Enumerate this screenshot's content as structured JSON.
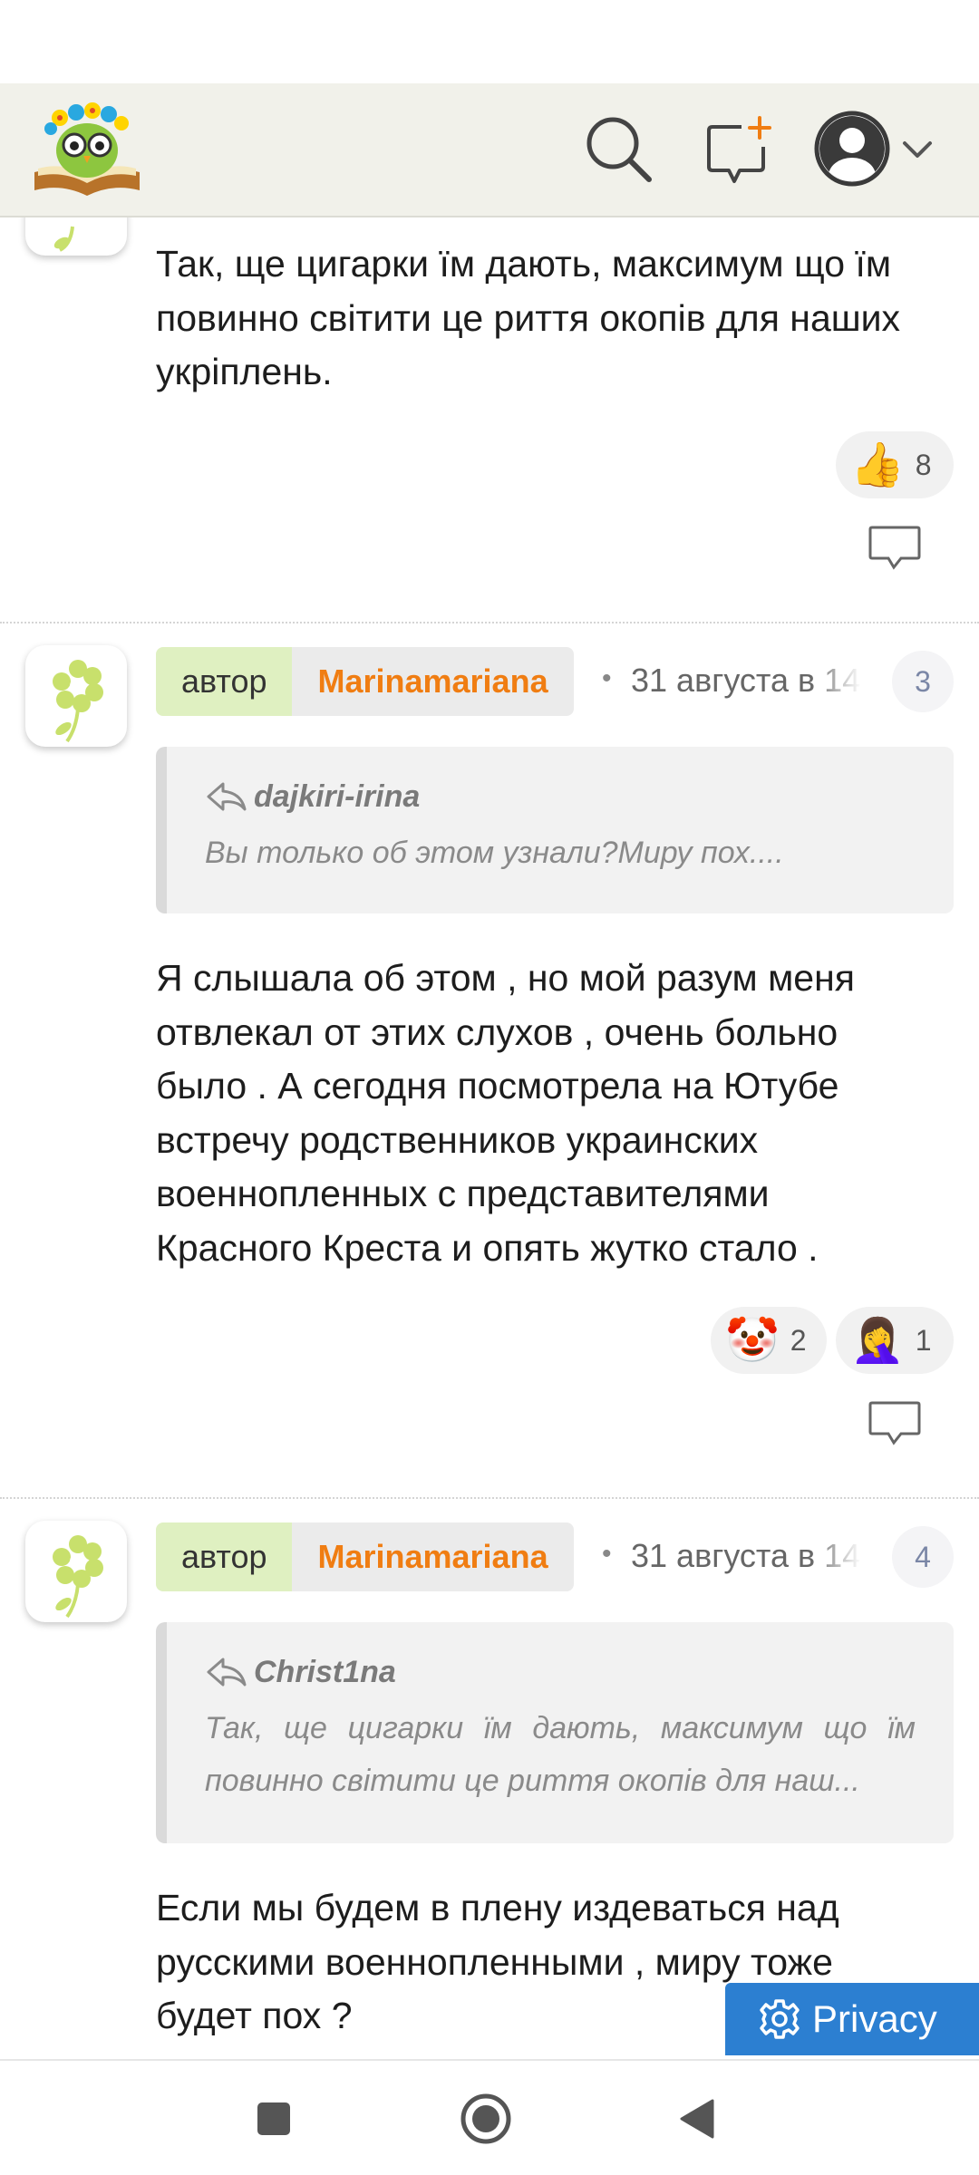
{
  "header": {
    "logo_icon": "owl-on-book-logo-icon",
    "search_icon": "search-icon",
    "new_post_icon": "chat-add-icon",
    "account_icon": "account-icon",
    "menu_icon": "chevron-down-icon"
  },
  "comments": [
    {
      "text": "Так, ще цигарки їм дають, максимум що їм повинно світити це риття окопів для наших укріплень.",
      "reactions": [
        {
          "icon": "thumbs-up-icon",
          "emoji": "👍",
          "count": "8"
        }
      ]
    },
    {
      "author_role": "автор",
      "author_name": "Marinamariana",
      "bullet": "•",
      "timestamp": "31 августа в 14",
      "number": "3",
      "quote": {
        "author": "dajkiri-irina",
        "text": "Вы только об этом узнали?Миру пох...."
      },
      "text": "Я слышала об этом , но мой разум меня отвлекал от этих слухов , очень больно было . А сегодня посмотрела на Ютубе встречу родственников украинских военнопленных с представителями Красного Креста и опять жутко стало .",
      "reactions": [
        {
          "icon": "clown-face-icon",
          "emoji": "🤡",
          "count": "2"
        },
        {
          "icon": "facepalm-icon",
          "emoji": "🤦‍♀️",
          "count": "1"
        }
      ]
    },
    {
      "author_role": "автор",
      "author_name": "Marinamariana",
      "bullet": "•",
      "timestamp": "31 августа в 14",
      "number": "4",
      "quote": {
        "author": "Christ1na",
        "text_line1": "Так, ще цигарки їм дають, максимум що їм",
        "text_line2": "повинно світити це риття окопів для наш..."
      },
      "text": "Если мы будем в плену издеваться над русскими военнопленными , миру тоже будет пох ?"
    }
  ],
  "privacy": {
    "label": "Privacy",
    "icon": "gear-icon"
  },
  "nav": {
    "square_icon": "recent-apps-icon",
    "home_icon": "home-icon",
    "back_icon": "back-icon"
  },
  "colors": {
    "header_bg": "#f1f1ea",
    "author_name": "#f07d12",
    "author_role_bg": "#dff0c1",
    "privacy_bg": "#2c7fd1",
    "avatar_flower": "#c8e06c"
  }
}
